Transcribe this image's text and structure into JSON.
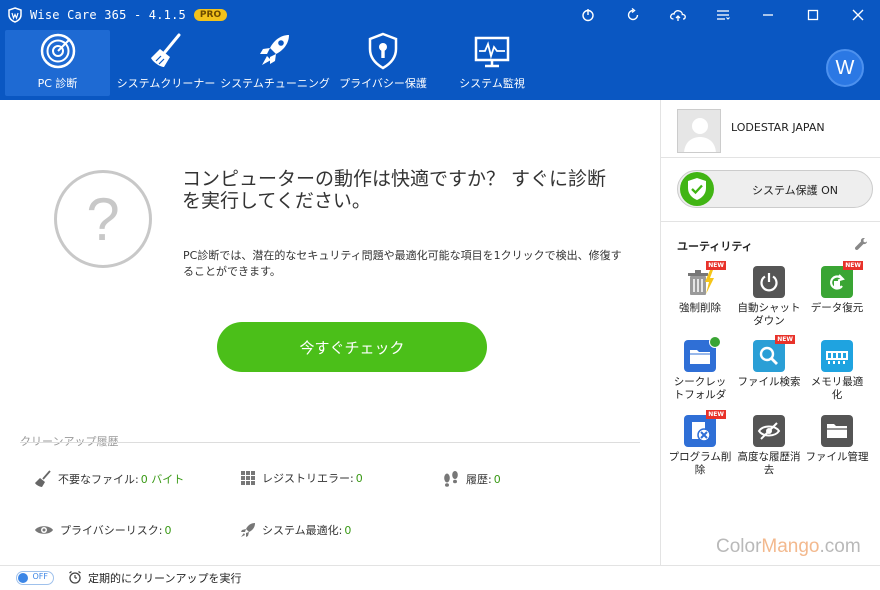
{
  "window": {
    "title": "Wise Care 365 - 4.1.5",
    "badge": "PRO"
  },
  "nav": {
    "items": [
      {
        "label": "PC 診断",
        "icon": "radar-icon"
      },
      {
        "label": "システムクリーナー",
        "icon": "broom-icon"
      },
      {
        "label": "システムチューニング",
        "icon": "rocket-icon"
      },
      {
        "label": "プライバシー保護",
        "icon": "shield-icon"
      },
      {
        "label": "システム監視",
        "icon": "monitor-icon"
      }
    ],
    "avatar_letter": "W"
  },
  "main": {
    "headline": "コンピューターの動作は快適ですか？ すぐに診断を実行してください。",
    "description": "PC診断では、潜在的なセキュリティ問題や最適化可能な項目を1クリックで検出、修復することができます。",
    "check_button": "今すぐチェック",
    "question_mark": "?"
  },
  "history": {
    "title": "クリーンアップ履歴",
    "items": [
      {
        "label": "不要なファイル:",
        "value": "0 バイト"
      },
      {
        "label": "レジストリエラー:",
        "value": "0"
      },
      {
        "label": "履歴:",
        "value": "0"
      },
      {
        "label": "プライバシーリスク:",
        "value": "0"
      },
      {
        "label": "システム最適化:",
        "value": "0"
      }
    ]
  },
  "sidebar": {
    "user_name": "LODESTAR JAPAN",
    "protection_label": "システム保護 ON",
    "utilities_title": "ユーティリティ",
    "utilities": [
      {
        "label": "強制削除",
        "badge": "NEW"
      },
      {
        "label": "自動シャットダウン",
        "badge": ""
      },
      {
        "label": "データ復元",
        "badge": "NEW"
      },
      {
        "label": "シークレットフォルダ",
        "badge": ""
      },
      {
        "label": "ファイル検索",
        "badge": "NEW"
      },
      {
        "label": "メモリ最適化",
        "badge": ""
      },
      {
        "label": "プログラム削除",
        "badge": "NEW"
      },
      {
        "label": "高度な履歴消去",
        "badge": ""
      },
      {
        "label": "ファイル管理",
        "badge": ""
      }
    ]
  },
  "statusbar": {
    "toggle_text": "OFF",
    "schedule_label": "定期的にクリーンアップを実行"
  },
  "watermark": {
    "part1": "Color",
    "part2": "Mango",
    "part3": ".com"
  },
  "colors": {
    "brand_blue": "#0a57c2",
    "check_green": "#4bbf19",
    "new_red": "#e8322a"
  }
}
